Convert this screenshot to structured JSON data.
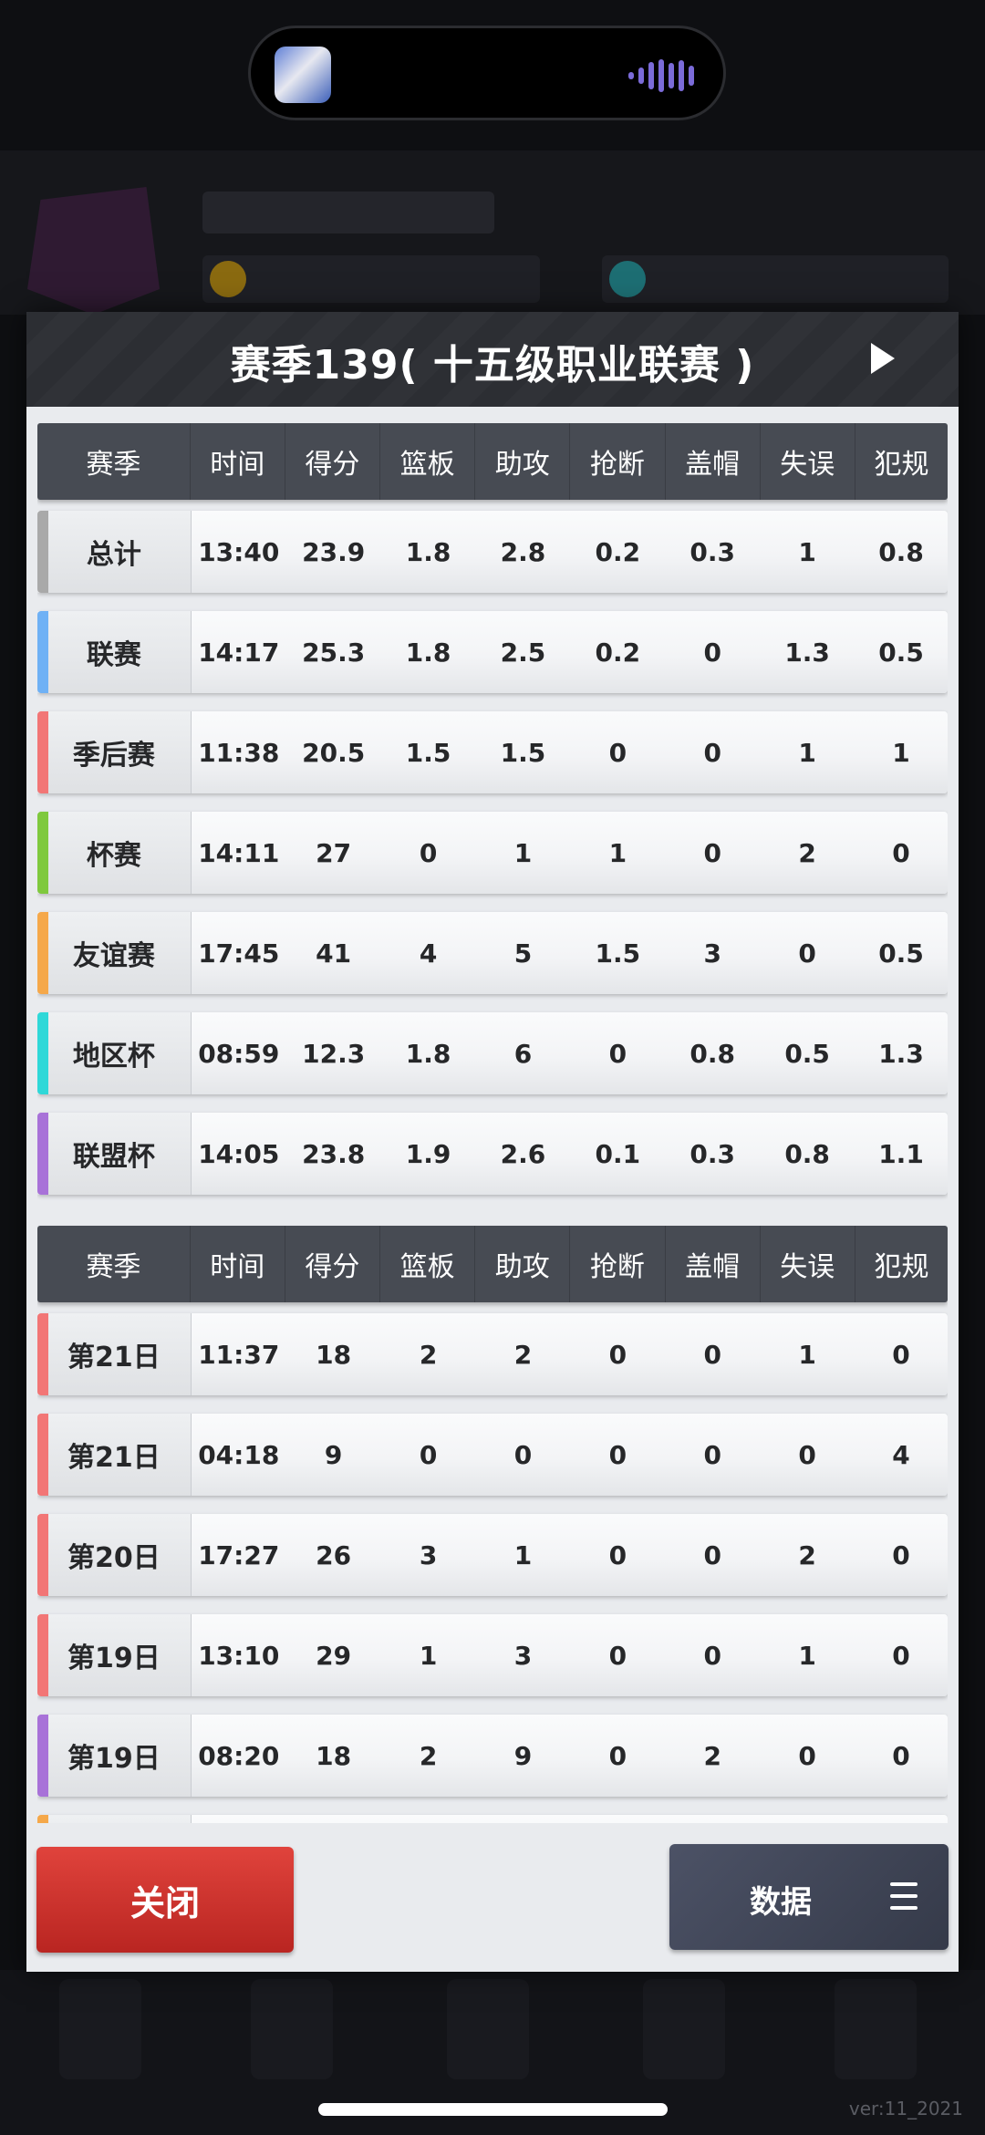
{
  "modal": {
    "title": "赛季139( 十五级职业联赛 )",
    "play_icon": "play-triangle-icon",
    "headers": [
      "赛季",
      "时间",
      "得分",
      "篮板",
      "助攻",
      "抢断",
      "盖帽",
      "失误",
      "犯规"
    ],
    "summary_rows": [
      {
        "label": "总计",
        "accent": "#a9a9a9",
        "values": [
          "13:40",
          "23.9",
          "1.8",
          "2.8",
          "0.2",
          "0.3",
          "1",
          "0.8"
        ]
      },
      {
        "label": "联赛",
        "accent": "#6fb1f5",
        "values": [
          "14:17",
          "25.3",
          "1.8",
          "2.5",
          "0.2",
          "0",
          "1.3",
          "0.5"
        ]
      },
      {
        "label": "季后赛",
        "accent": "#f27676",
        "values": [
          "11:38",
          "20.5",
          "1.5",
          "1.5",
          "0",
          "0",
          "1",
          "1"
        ]
      },
      {
        "label": "杯赛",
        "accent": "#7fc93e",
        "values": [
          "14:11",
          "27",
          "0",
          "1",
          "1",
          "0",
          "2",
          "0"
        ]
      },
      {
        "label": "友谊赛",
        "accent": "#f5a84a",
        "values": [
          "17:45",
          "41",
          "4",
          "5",
          "1.5",
          "3",
          "0",
          "0.5"
        ]
      },
      {
        "label": "地区杯",
        "accent": "#2fd8d8",
        "values": [
          "08:59",
          "12.3",
          "1.8",
          "6",
          "0",
          "0.8",
          "0.5",
          "1.3"
        ]
      },
      {
        "label": "联盟杯",
        "accent": "#a872d8",
        "values": [
          "14:05",
          "23.8",
          "1.9",
          "2.6",
          "0.1",
          "0.3",
          "0.8",
          "1.1"
        ]
      }
    ],
    "game_rows": [
      {
        "label": "第21日",
        "accent": "#f27676",
        "values": [
          "11:37",
          "18",
          "2",
          "2",
          "0",
          "0",
          "1",
          "0"
        ]
      },
      {
        "label": "第21日",
        "accent": "#f27676",
        "values": [
          "04:18",
          "9",
          "0",
          "0",
          "0",
          "0",
          "0",
          "4"
        ]
      },
      {
        "label": "第20日",
        "accent": "#f27676",
        "values": [
          "17:27",
          "26",
          "3",
          "1",
          "0",
          "0",
          "2",
          "0"
        ]
      },
      {
        "label": "第19日",
        "accent": "#f27676",
        "values": [
          "13:10",
          "29",
          "1",
          "3",
          "0",
          "0",
          "1",
          "0"
        ]
      },
      {
        "label": "第19日",
        "accent": "#a872d8",
        "values": [
          "08:20",
          "18",
          "2",
          "9",
          "0",
          "2",
          "0",
          "0"
        ]
      },
      {
        "label": "",
        "accent": "#f5a84a",
        "values": [
          "",
          "",
          "",
          "",
          "",
          "",
          "",
          ""
        ]
      }
    ],
    "close_label": "关闭",
    "data_label": "数据",
    "menu_icon": "hamburger-menu-icon"
  },
  "background": {
    "version_text": "ver:11_2021"
  }
}
